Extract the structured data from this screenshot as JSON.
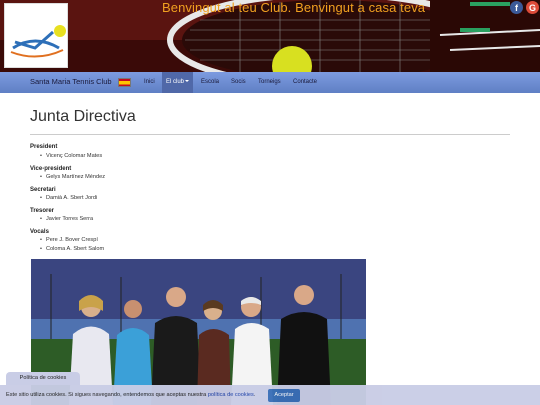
{
  "header": {
    "tagline": "Benvingut al teu Club. Benvingut a casa teva",
    "logo_icon": "club-logo",
    "social": [
      {
        "icon": "facebook-icon",
        "glyph": "f"
      },
      {
        "icon": "google-plus-icon",
        "glyph": "G"
      }
    ]
  },
  "navbar": {
    "brand": "Santa Maria Tennis Club",
    "language_icon": "spain-flag-icon",
    "items": [
      {
        "label": "Inici"
      },
      {
        "label": "El club"
      },
      {
        "label": "Escola"
      },
      {
        "label": "Socis"
      },
      {
        "label": "Torneigs"
      },
      {
        "label": "Contacte"
      }
    ],
    "active_item": "El club"
  },
  "main": {
    "title": "Junta Directiva",
    "sections": [
      {
        "role": "President",
        "members": [
          "Vicenç Colomar Mates"
        ]
      },
      {
        "role": "Vice-president",
        "members": [
          "Gelys Martínez Méndez"
        ]
      },
      {
        "role": "Secretari",
        "members": [
          "Damià A. Sbert Jordi"
        ]
      },
      {
        "role": "Tresorer",
        "members": [
          "Javier Torres Serra"
        ]
      },
      {
        "role": "Vocals",
        "members": [
          "Pere J. Bover Crespí",
          "Coloma A. Sbert Salom"
        ]
      }
    ]
  },
  "cookies": {
    "tab_label": "Política de cookies",
    "text_before": "Este sitio utiliza cookies. Si sigues navegando, entendemos que aceptas nuestra ",
    "link_text": "política de cookies",
    "text_after": ".",
    "accept_label": "Aceptar"
  }
}
